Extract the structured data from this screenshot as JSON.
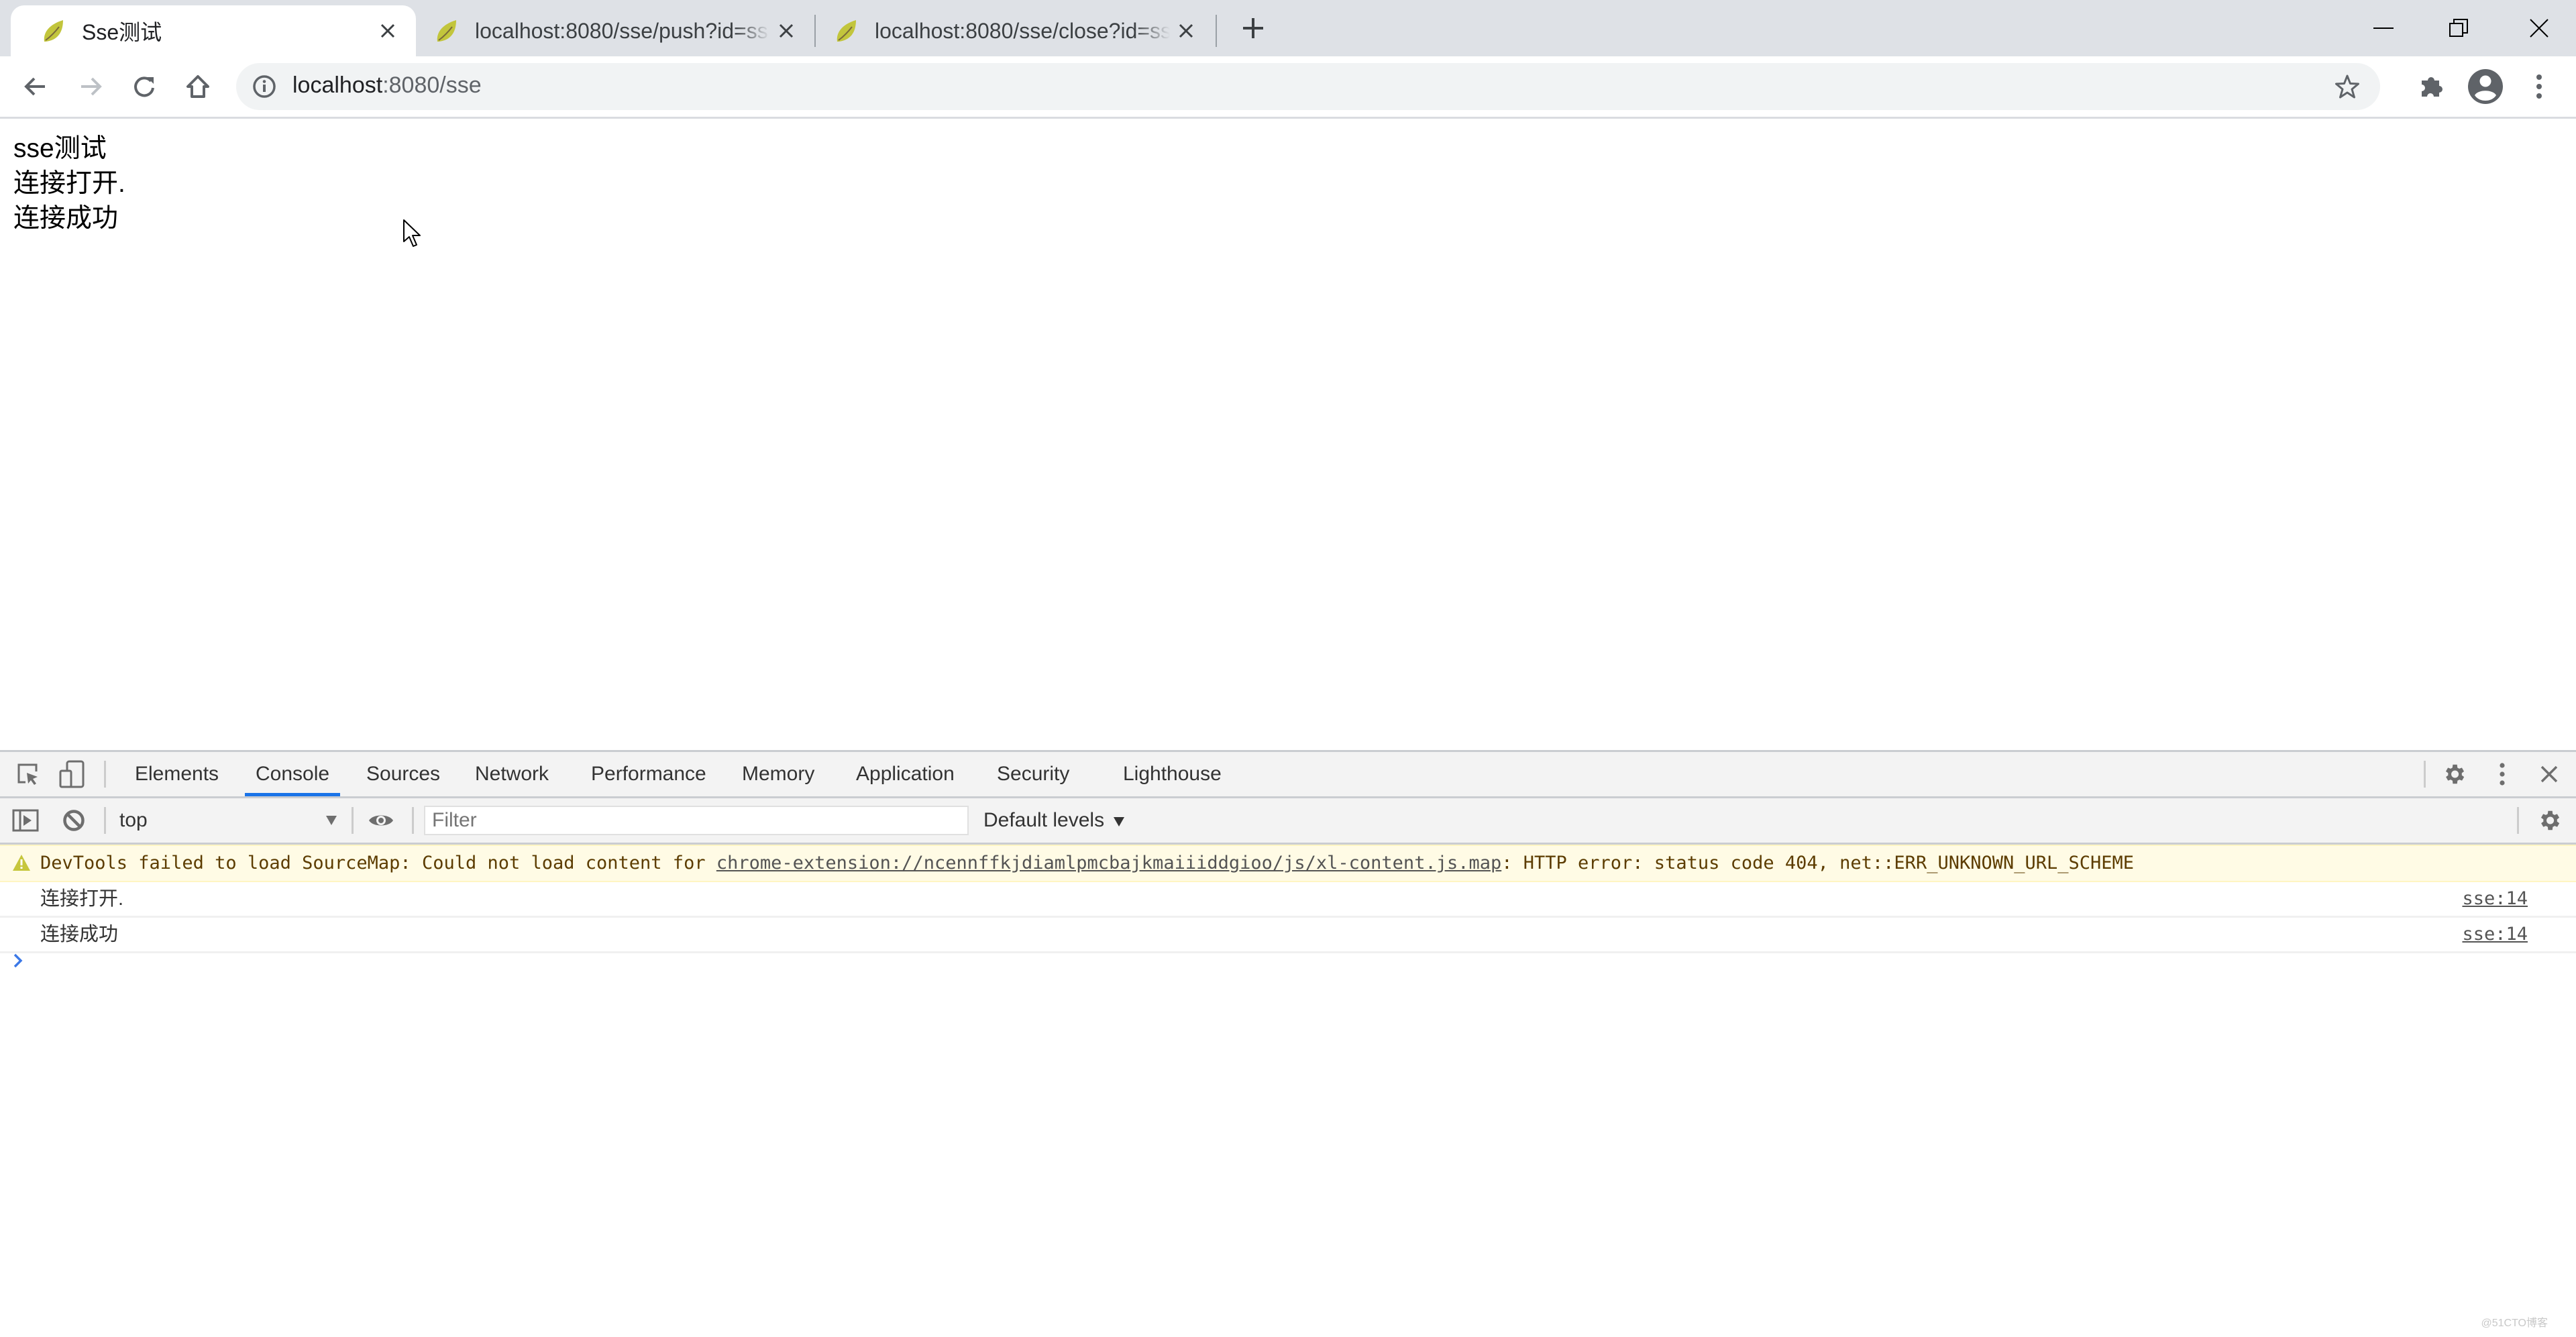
{
  "browser": {
    "tabs": [
      {
        "title": "Sse测试",
        "active": true,
        "favicon": "spring-leaf-icon"
      },
      {
        "title": "localhost:8080/sse/push?id=ss",
        "active": false,
        "favicon": "spring-leaf-icon"
      },
      {
        "title": "localhost:8080/sse/close?id=ss",
        "active": false,
        "favicon": "spring-leaf-icon"
      }
    ],
    "new_tab_icon": "plus-icon",
    "window_controls": [
      "minimize-icon",
      "restore-icon",
      "close-icon"
    ],
    "address_bar": {
      "host": "localhost",
      "rest": ":8080/sse",
      "info_icon": "info-icon"
    },
    "toolbar_icons": [
      "back-icon",
      "forward-icon",
      "reload-icon",
      "home-icon",
      "star-icon",
      "extensions-icon",
      "profile-icon",
      "menu-icon"
    ]
  },
  "page": {
    "lines": [
      "sse测试",
      "连接打开.",
      "连接成功"
    ]
  },
  "devtools": {
    "tabs": [
      "Elements",
      "Console",
      "Sources",
      "Network",
      "Performance",
      "Memory",
      "Application",
      "Security",
      "Lighthouse"
    ],
    "active_tab": "Console",
    "console_bar": {
      "context": "top",
      "filter_placeholder": "Filter",
      "levels": "Default levels"
    },
    "messages": [
      {
        "type": "warning",
        "prefix": "DevTools failed to load SourceMap: Could not load content for ",
        "link": "chrome-extension://ncennffkjdiamlpmcbajkmaiiiddgioo/js/xl-content.js.map",
        "suffix": ": HTTP error: status code 404, net::ERR_UNKNOWN_URL_SCHEME"
      },
      {
        "type": "log",
        "text": "连接打开.",
        "source": "sse:14"
      },
      {
        "type": "log",
        "text": "连接成功",
        "source": "sse:14"
      }
    ]
  },
  "colors": {
    "accent": "#1a73e8",
    "warning_bg": "#fffbe5",
    "warning_text": "#5c3c00",
    "favicon": "#c2c53c"
  },
  "watermark": "@51CTO博客"
}
